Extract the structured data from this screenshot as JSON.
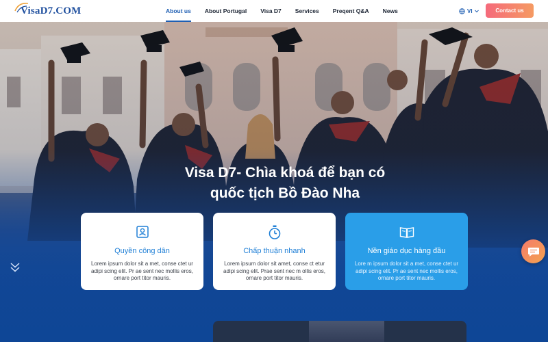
{
  "header": {
    "logo_text": "VisaD7.COM",
    "nav": [
      {
        "label": "About us",
        "active": true
      },
      {
        "label": "About Portugal",
        "active": false
      },
      {
        "label": "Visa D7",
        "active": false
      },
      {
        "label": "Services",
        "active": false
      },
      {
        "label": "Preqent Q&A",
        "active": false
      },
      {
        "label": "News",
        "active": false
      }
    ],
    "language": "VI",
    "contact_label": "Contact us"
  },
  "hero": {
    "title_line1": "Visa D7- Chìa khoá để bạn có",
    "title_line2": "quốc tịch Bồ Đào Nha"
  },
  "cards": [
    {
      "icon": "user-card-icon",
      "title": "Quyền công dân",
      "text": "Lorem ipsum dolor sit a met, conse ctet ur adipi scing elit. Pr ae sent nec mollis eros, ornare port titor mauris."
    },
    {
      "icon": "stopwatch-icon",
      "title": "Chấp thuận nhanh",
      "text": "Lorem ipsum dolor sit amet, conse ct etur adipi scing elit. Prae sent nec m ollis eros, ornare port titor mauris."
    },
    {
      "icon": "open-book-icon",
      "title": "Nền giáo dục hàng đầu",
      "text": "Lore m ipsum dolor sit a met, conse ctet ur adipi scing elit. Pr ae sent nec mollis eros, ornare port titor mauris."
    }
  ],
  "colors": {
    "brand_blue": "#1f5fb3",
    "accent_card": "#2a9ee8",
    "contact_gradient_start": "#f56a7b",
    "contact_gradient_end": "#f59a62"
  }
}
